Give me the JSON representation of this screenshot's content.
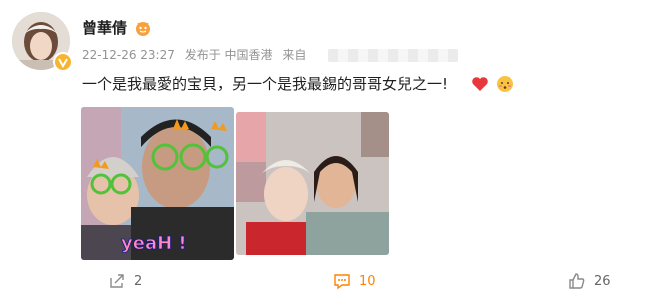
{
  "post": {
    "username": "曾華倩",
    "date": "22-12-26 23:27",
    "posted_from_label": "发布于 中国香港",
    "source_label": "来自",
    "text": "一个是我最愛的宝貝，另一个是我最錫的哥哥女兒之一!"
  },
  "photo1": {
    "caption": "yeaH !"
  },
  "actions": {
    "forward_count": "2",
    "comment_count": "10",
    "like_count": "26"
  },
  "icons": {
    "vip": "vip-badge-icon",
    "level": "level-icon",
    "heart": "red-heart-icon",
    "face": "shy-face-icon",
    "forward": "share-icon",
    "comment": "comment-icon",
    "like": "thumbs-up-icon"
  },
  "colors": {
    "comment_accent": "#ff8200",
    "vip_badge": "#f6b530",
    "heart": "#e8383d"
  }
}
